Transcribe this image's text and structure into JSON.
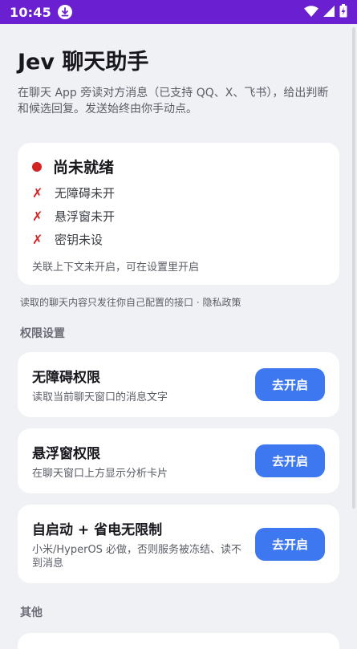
{
  "status_bar": {
    "time": "10:45"
  },
  "header": {
    "title": "Jev 聊天助手",
    "subtitle": "在聊天 App 旁读对方消息（已支持 QQ、X、飞书），给出判断和候选回复。发送始终由你手动点。"
  },
  "status_card": {
    "title": "尚未就绪",
    "checks": [
      {
        "label": "无障碍未开"
      },
      {
        "label": "悬浮窗未开"
      },
      {
        "label": "密钥未设"
      }
    ],
    "note": "关联上下文未开启，可在设置里开启"
  },
  "privacy_note": "读取的聊天内容只发往你自己配置的接口 · 隐私政策",
  "permissions": {
    "section_title": "权限设置",
    "items": [
      {
        "title": "无障碍权限",
        "desc": "读取当前聊天窗口的消息文字",
        "button": "去开启"
      },
      {
        "title": "悬浮窗权限",
        "desc": "在聊天窗口上方显示分析卡片",
        "button": "去开启"
      },
      {
        "title": "自启动 + 省电无限制",
        "desc": "小米/HyperOS 必做，否则服务被冻结、读不到消息",
        "button": "去开启"
      }
    ]
  },
  "other": {
    "section_title": "其他"
  },
  "colors": {
    "status_bar": "#6a1fd1",
    "accent": "#3e78f0",
    "error": "#d42323"
  }
}
